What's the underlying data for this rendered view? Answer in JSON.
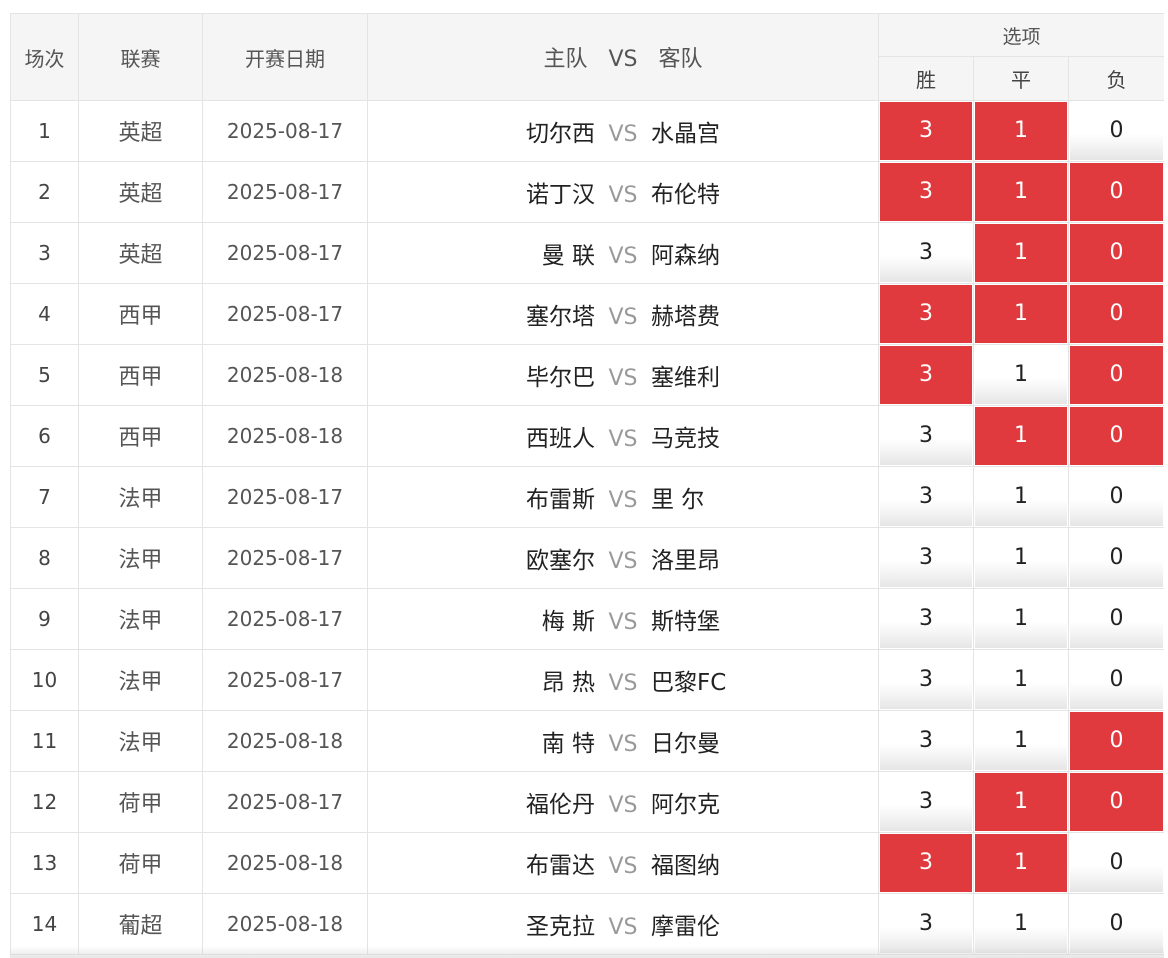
{
  "header": {
    "col_index": "场次",
    "col_league": "联赛",
    "col_date": "开赛日期",
    "col_match_home": "主队",
    "col_match_vs": "VS",
    "col_match_away": "客队",
    "col_options": "选项",
    "opt_win": "胜",
    "opt_draw": "平",
    "opt_loss": "负"
  },
  "colors": {
    "selected": "#e03a3e",
    "header_bg": "#f5f5f5"
  },
  "vs_label": "VS",
  "rows": [
    {
      "idx": "1",
      "league": "英超",
      "date": "2025-08-17",
      "home": "切尔西",
      "away": "水晶宫",
      "win": "3",
      "draw": "1",
      "loss": "0",
      "sel": [
        true,
        true,
        false
      ]
    },
    {
      "idx": "2",
      "league": "英超",
      "date": "2025-08-17",
      "home": "诺丁汉",
      "away": "布伦特",
      "win": "3",
      "draw": "1",
      "loss": "0",
      "sel": [
        true,
        true,
        true
      ]
    },
    {
      "idx": "3",
      "league": "英超",
      "date": "2025-08-17",
      "home": "曼 联",
      "away": "阿森纳",
      "win": "3",
      "draw": "1",
      "loss": "0",
      "sel": [
        false,
        true,
        true
      ]
    },
    {
      "idx": "4",
      "league": "西甲",
      "date": "2025-08-17",
      "home": "塞尔塔",
      "away": "赫塔费",
      "win": "3",
      "draw": "1",
      "loss": "0",
      "sel": [
        true,
        true,
        true
      ]
    },
    {
      "idx": "5",
      "league": "西甲",
      "date": "2025-08-18",
      "home": "毕尔巴",
      "away": "塞维利",
      "win": "3",
      "draw": "1",
      "loss": "0",
      "sel": [
        true,
        false,
        true
      ]
    },
    {
      "idx": "6",
      "league": "西甲",
      "date": "2025-08-18",
      "home": "西班人",
      "away": "马竞技",
      "win": "3",
      "draw": "1",
      "loss": "0",
      "sel": [
        false,
        true,
        true
      ]
    },
    {
      "idx": "7",
      "league": "法甲",
      "date": "2025-08-17",
      "home": "布雷斯",
      "away": "里 尔",
      "win": "3",
      "draw": "1",
      "loss": "0",
      "sel": [
        false,
        false,
        false
      ]
    },
    {
      "idx": "8",
      "league": "法甲",
      "date": "2025-08-17",
      "home": "欧塞尔",
      "away": "洛里昂",
      "win": "3",
      "draw": "1",
      "loss": "0",
      "sel": [
        false,
        false,
        false
      ]
    },
    {
      "idx": "9",
      "league": "法甲",
      "date": "2025-08-17",
      "home": "梅 斯",
      "away": "斯特堡",
      "win": "3",
      "draw": "1",
      "loss": "0",
      "sel": [
        false,
        false,
        false
      ]
    },
    {
      "idx": "10",
      "league": "法甲",
      "date": "2025-08-17",
      "home": "昂 热",
      "away": "巴黎FC",
      "win": "3",
      "draw": "1",
      "loss": "0",
      "sel": [
        false,
        false,
        false
      ]
    },
    {
      "idx": "11",
      "league": "法甲",
      "date": "2025-08-18",
      "home": "南 特",
      "away": "日尔曼",
      "win": "3",
      "draw": "1",
      "loss": "0",
      "sel": [
        false,
        false,
        true
      ]
    },
    {
      "idx": "12",
      "league": "荷甲",
      "date": "2025-08-17",
      "home": "福伦丹",
      "away": "阿尔克",
      "win": "3",
      "draw": "1",
      "loss": "0",
      "sel": [
        false,
        true,
        true
      ]
    },
    {
      "idx": "13",
      "league": "荷甲",
      "date": "2025-08-18",
      "home": "布雷达",
      "away": "福图纳",
      "win": "3",
      "draw": "1",
      "loss": "0",
      "sel": [
        true,
        true,
        false
      ]
    },
    {
      "idx": "14",
      "league": "葡超",
      "date": "2025-08-18",
      "home": "圣克拉",
      "away": "摩雷伦",
      "win": "3",
      "draw": "1",
      "loss": "0",
      "sel": [
        false,
        false,
        false
      ]
    }
  ]
}
